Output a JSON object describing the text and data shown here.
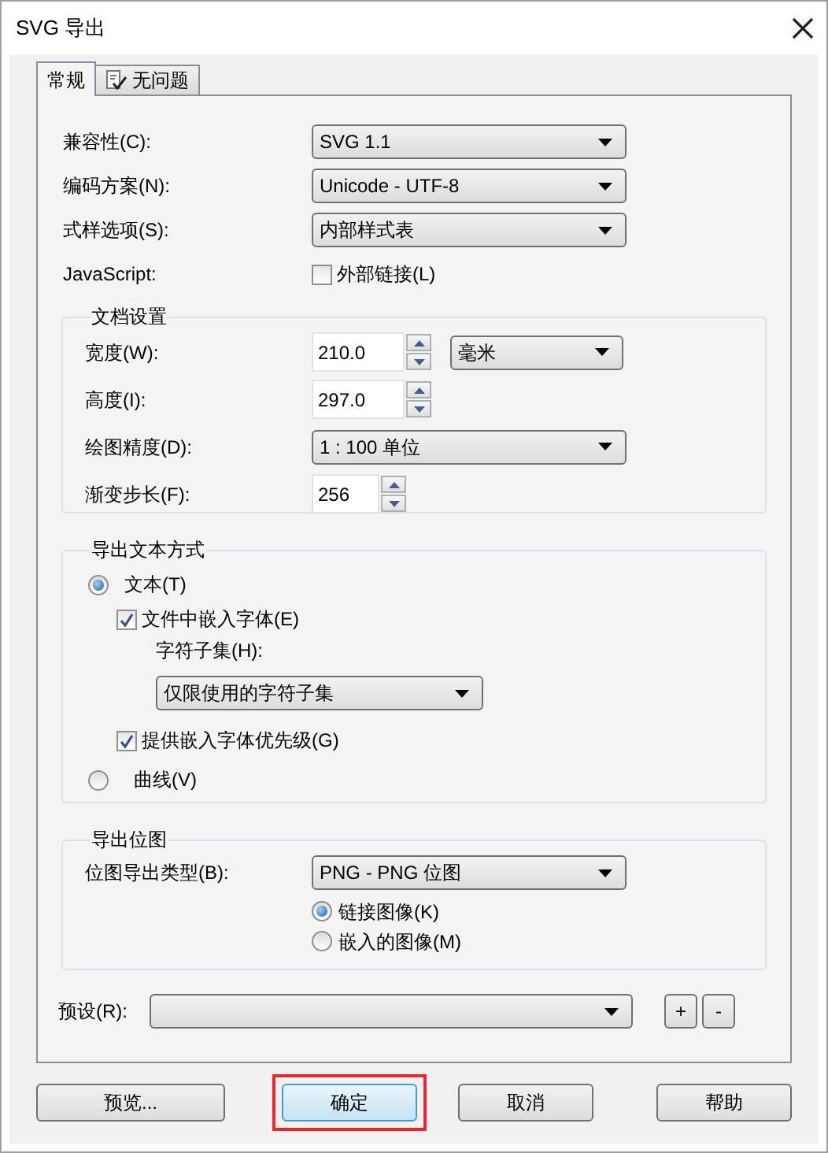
{
  "window": {
    "title": "SVG 导出"
  },
  "tabs": [
    {
      "label": "常规",
      "selected": true,
      "kind": "plain"
    },
    {
      "label": "无问题",
      "selected": false,
      "kind": "status"
    }
  ],
  "general": [
    {
      "label": "兼容性(C):",
      "kind": "dropdown",
      "value": "SVG 1.1"
    },
    {
      "label": "编码方案(N):",
      "kind": "dropdown",
      "value": "Unicode - UTF-8"
    },
    {
      "label": "式样选项(S):",
      "kind": "dropdown",
      "value": "内部样式表"
    },
    {
      "label": "JavaScript:",
      "kind": "checkbox",
      "option": "外部链接(L)",
      "checked": false
    }
  ],
  "document_settings": {
    "title": "文档设置",
    "rows": [
      {
        "label": "宽度(W):",
        "kind": "spinner",
        "value": "210.0",
        "unit": "毫米"
      },
      {
        "label": "高度(I):",
        "kind": "spinner",
        "value": "297.0"
      },
      {
        "label": "绘图精度(D):",
        "kind": "dropdown",
        "value": "1 : 100 单位"
      },
      {
        "label": "渐变步长(F):",
        "kind": "short_spinner",
        "value": "256"
      }
    ]
  },
  "export_text": {
    "title": "导出文本方式",
    "text_option": {
      "label": "文本(T)",
      "selected": true
    },
    "embed_fonts": {
      "label": "文件中嵌入字体(E)",
      "checked": true
    },
    "subset_label": "字符子集(H):",
    "subset_value": "仅限使用的字符子集",
    "font_priority": {
      "label": "提供嵌入字体优先级(G)",
      "checked": true
    },
    "curve_option": {
      "label": "曲线(V)",
      "selected": false
    }
  },
  "export_bitmap": {
    "title": "导出位图",
    "type_label": "位图导出类型(B):",
    "type_value": "PNG - PNG 位图",
    "options": [
      {
        "label": "链接图像(K)",
        "selected": true
      },
      {
        "label": "嵌入的图像(M)",
        "selected": false
      }
    ]
  },
  "preset": {
    "label": "预设(R):",
    "buttons": [
      "+",
      "-"
    ]
  },
  "buttons": [
    {
      "label": "预览...",
      "default": false,
      "highlighted": false
    },
    {
      "label": "确定",
      "default": true,
      "highlighted": true
    },
    {
      "label": "取消",
      "default": false,
      "highlighted": false
    },
    {
      "label": "帮助",
      "default": false,
      "highlighted": false
    }
  ]
}
